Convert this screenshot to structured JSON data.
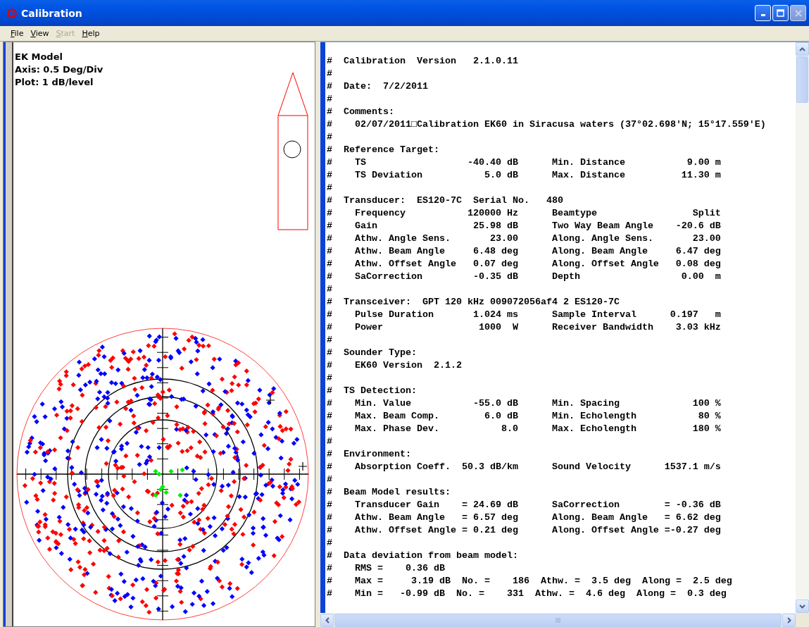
{
  "window": {
    "title": "Calibration"
  },
  "menu": [
    {
      "label": "File",
      "disabled": false
    },
    {
      "label": "View",
      "disabled": false
    },
    {
      "label": "Start",
      "disabled": true
    },
    {
      "label": "Help",
      "disabled": false
    }
  ],
  "plot_panel": {
    "lines": [
      "EK Model",
      "Axis: 0.5 Deg/Div",
      "Plot: 1 dB/level"
    ]
  },
  "report": {
    "lines": [
      {
        "kind": "head",
        "cells": [
          "#",
          "Calibration  Version   2.1.0.11"
        ]
      },
      {
        "kind": "blank",
        "cells": [
          "#"
        ]
      },
      {
        "kind": "head",
        "cells": [
          "#",
          "Date:  7/2/2011"
        ]
      },
      {
        "kind": "blank",
        "cells": [
          "#"
        ]
      },
      {
        "kind": "head",
        "cells": [
          "#",
          "Comments:"
        ]
      },
      {
        "kind": "item",
        "cells": [
          "#",
          "02/07/2011□Calibration EK60 in Siracusa waters (37°02.698′N; 15°17.559′E)"
        ]
      },
      {
        "kind": "blank",
        "cells": [
          "#"
        ]
      },
      {
        "kind": "head",
        "cells": [
          "#",
          "Reference Target:"
        ]
      },
      {
        "kind": "pair",
        "cells": [
          "#",
          "TS",
          "-40.40 dB",
          "Min. Distance",
          "9.00 m"
        ]
      },
      {
        "kind": "pair",
        "cells": [
          "#",
          "TS Deviation",
          "5.0 dB",
          "Max. Distance",
          "11.30 m"
        ]
      },
      {
        "kind": "blank",
        "cells": [
          "#"
        ]
      },
      {
        "kind": "head",
        "cells": [
          "#",
          "Transducer:  ES120-7C  Serial No.   480"
        ]
      },
      {
        "kind": "pair",
        "cells": [
          "#",
          "Frequency",
          "120000 Hz",
          "Beamtype",
          "Split"
        ]
      },
      {
        "kind": "pair",
        "cells": [
          "#",
          "Gain",
          "25.98 dB",
          "Two Way Beam Angle",
          "-20.6 dB"
        ]
      },
      {
        "kind": "pair",
        "cells": [
          "#",
          "Athw. Angle Sens.",
          "23.00",
          "Along. Angle Sens.",
          "23.00"
        ]
      },
      {
        "kind": "pair",
        "cells": [
          "#",
          "Athw. Beam Angle",
          "6.48 deg",
          "Along. Beam Angle",
          "6.47 deg"
        ]
      },
      {
        "kind": "pair",
        "cells": [
          "#",
          "Athw. Offset Angle",
          "0.07 deg",
          "Along. Offset Angle",
          "0.08 deg"
        ]
      },
      {
        "kind": "pair",
        "cells": [
          "#",
          "SaCorrection",
          "-0.35 dB",
          "Depth",
          "0.00  m"
        ]
      },
      {
        "kind": "blank",
        "cells": [
          "#"
        ]
      },
      {
        "kind": "head",
        "cells": [
          "#",
          "Transceiver:  GPT 120 kHz 009072056af4 2 ES120-7C"
        ]
      },
      {
        "kind": "pair",
        "cells": [
          "#",
          "Pulse Duration",
          "1.024 ms",
          "Sample Interval",
          "0.197   m"
        ]
      },
      {
        "kind": "pair",
        "cells": [
          "#",
          "Power",
          "1000  W",
          "Receiver Bandwidth",
          "3.03 kHz"
        ]
      },
      {
        "kind": "blank",
        "cells": [
          "#"
        ]
      },
      {
        "kind": "head",
        "cells": [
          "#",
          "Sounder Type:"
        ]
      },
      {
        "kind": "item",
        "cells": [
          "#",
          "EK60 Version  2.1.2"
        ]
      },
      {
        "kind": "blank",
        "cells": [
          "#"
        ]
      },
      {
        "kind": "head",
        "cells": [
          "#",
          "TS Detection:"
        ]
      },
      {
        "kind": "pair",
        "cells": [
          "#",
          "Min. Value",
          "-55.0 dB",
          "Min. Spacing",
          "100 %"
        ]
      },
      {
        "kind": "pair",
        "cells": [
          "#",
          "Max. Beam Comp.",
          "6.0 dB",
          "Min. Echolength",
          "80 %"
        ]
      },
      {
        "kind": "pair",
        "cells": [
          "#",
          "Max. Phase Dev.",
          "8.0",
          "Max. Echolength",
          "180 %"
        ]
      },
      {
        "kind": "blank",
        "cells": [
          "#"
        ]
      },
      {
        "kind": "head",
        "cells": [
          "#",
          "Environment:"
        ]
      },
      {
        "kind": "pair",
        "cells": [
          "#",
          "Absorption Coeff.",
          "50.3 dB/km",
          "Sound Velocity",
          "1537.1 m/s"
        ]
      },
      {
        "kind": "blank",
        "cells": [
          "#"
        ]
      },
      {
        "kind": "head",
        "cells": [
          "#",
          "Beam Model results:"
        ]
      },
      {
        "kind": "pair",
        "cells": [
          "#",
          "Transducer Gain",
          "= 24.69 dB",
          "SaCorrection",
          "= -0.36 dB"
        ]
      },
      {
        "kind": "pair",
        "cells": [
          "#",
          "Athw. Beam Angle",
          "= 6.57 deg",
          "Along. Beam Angle",
          "= 6.62 deg"
        ]
      },
      {
        "kind": "pair",
        "cells": [
          "#",
          "Athw. Offset Angle",
          "= 0.21 deg",
          "Along. Offset Angle",
          "=-0.27 deg"
        ]
      },
      {
        "kind": "blank",
        "cells": [
          "#"
        ]
      },
      {
        "kind": "head",
        "cells": [
          "#",
          "Data deviation from beam model:"
        ]
      },
      {
        "kind": "item",
        "cells": [
          "#",
          "RMS =    0.36 dB"
        ]
      },
      {
        "kind": "item",
        "cells": [
          "#",
          "Max =     3.19 dB  No. =    186  Athw. =  3.5 deg  Along =  2.5 deg"
        ]
      },
      {
        "kind": "item",
        "cells": [
          "#",
          "Min =   -0.99 dB  No. =    331  Athw. =  4.6 deg  Along =  0.3 deg"
        ]
      }
    ]
  }
}
